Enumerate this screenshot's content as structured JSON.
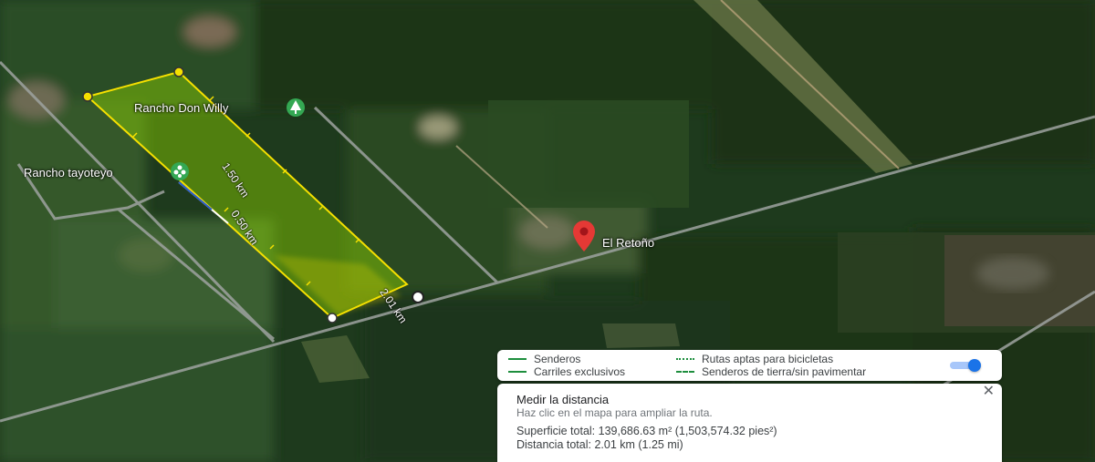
{
  "map": {
    "places": [
      {
        "label": "Rancho Don Willy",
        "icon": "park-icon"
      },
      {
        "label": "Rancho tayoteyo",
        "icon": "flower-icon"
      },
      {
        "label": "El Retoño",
        "icon": "map-pin-icon"
      }
    ],
    "measure_labels": {
      "segment_long": "1.50 km",
      "segment_mid": "0.50 km",
      "segment_total": "2.01 km"
    },
    "colors": {
      "measure_line": "#f5e000",
      "measured_area": "#8fd400",
      "pin": "#e53935",
      "road": "#9ea3a0"
    }
  },
  "legend": {
    "items": [
      {
        "label": "Senderos",
        "style": "solid"
      },
      {
        "label": "Carriles exclusivos",
        "style": "solid"
      },
      {
        "label": "Rutas aptas para bicicletas",
        "style": "dotted"
      },
      {
        "label": "Senderos de tierra/sin pavimentar",
        "style": "dashed"
      }
    ],
    "toggle_on": true,
    "accent": "#1a73e8"
  },
  "measure_panel": {
    "title": "Medir la distancia",
    "hint": "Haz clic en el mapa para ampliar la ruta.",
    "area": "Superficie total: 139,686.63 m² (1,503,574.32 pies²)",
    "distance": "Distancia total: 2.01 km (1.25 mi)",
    "close_icon": "close-icon"
  }
}
